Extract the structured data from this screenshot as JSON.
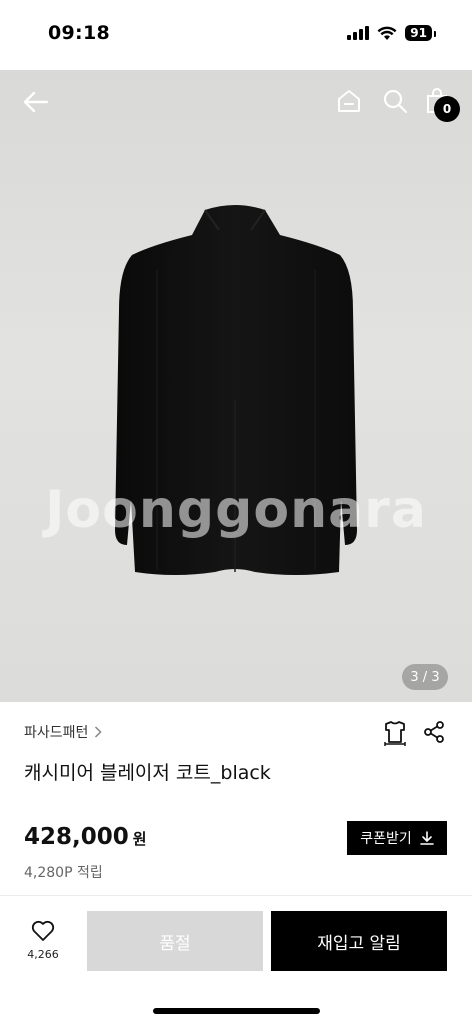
{
  "status_bar": {
    "time": "09:18",
    "battery": "91"
  },
  "header": {
    "cart_count": "0"
  },
  "hero": {
    "watermark": "Joonggonara",
    "page_indicator": "3 / 3"
  },
  "product": {
    "brand": "파사드패턴",
    "title": "캐시미어 블레이저 코트_black",
    "price": "428,000",
    "price_unit": "원",
    "points": "4,280P 적립",
    "coupon_label": "쿠폰받기"
  },
  "bottom_bar": {
    "like_count": "4,266",
    "soldout_label": "품절",
    "restock_label": "재입고 알림"
  },
  "icons": [
    "back-arrow-icon",
    "home-icon",
    "search-icon",
    "shopping-bag-icon",
    "hanger-icon",
    "share-icon",
    "download-icon",
    "heart-icon"
  ]
}
